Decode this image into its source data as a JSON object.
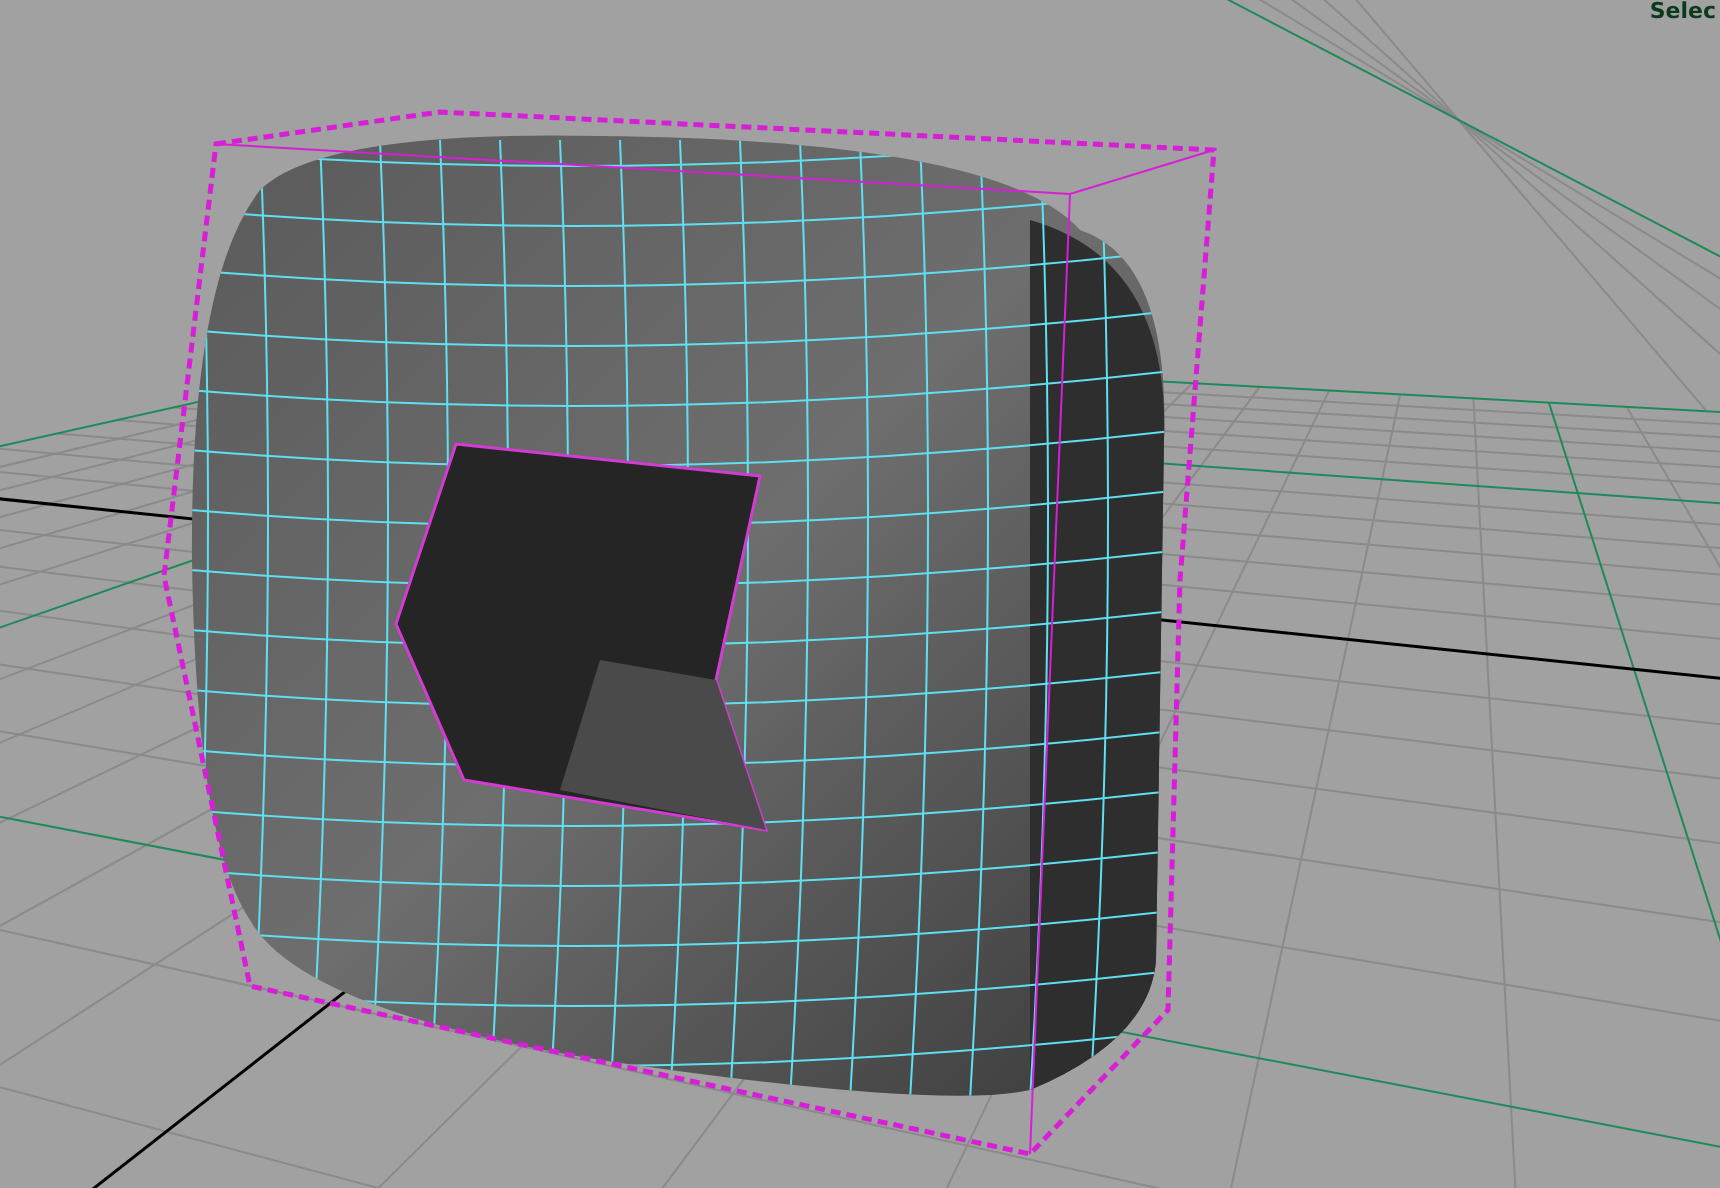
{
  "viewport": {
    "status_text": "Selec"
  }
}
